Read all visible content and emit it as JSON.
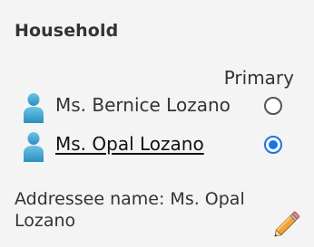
{
  "household": {
    "title": "Household",
    "primary_label": "Primary",
    "members": [
      {
        "name": "Ms. Bernice Lozano",
        "primary": false,
        "icon": "person-icon"
      },
      {
        "name": "Ms. Opal Lozano",
        "primary": true,
        "icon": "person-icon"
      }
    ],
    "addressee_label": "Addressee name:",
    "addressee_value": "Ms. Opal Lozano",
    "edit_icon": "pencil-icon"
  },
  "colors": {
    "person_icon": "#3fa6d0",
    "radio_selected": "#1a73e8",
    "text": "#333333"
  }
}
